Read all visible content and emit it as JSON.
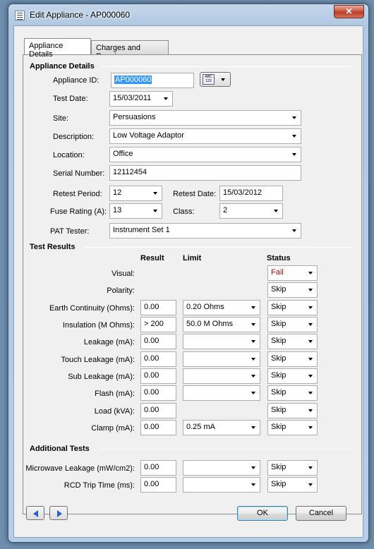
{
  "window": {
    "title": "Edit Appliance - AP000060",
    "close_glyph": "✕"
  },
  "tabs": [
    {
      "label": "Appliance Details"
    },
    {
      "label": "Charges and Repairs"
    }
  ],
  "appliance_details": {
    "section_title": "Appliance Details",
    "appliance_id": {
      "label": "Appliance ID:",
      "value": "AP000060"
    },
    "format_button": {
      "icon": "abc-123-icon",
      "top": "ABC",
      "bottom": "123"
    },
    "test_date": {
      "label": "Test Date:",
      "value": "15/03/2011"
    },
    "site": {
      "label": "Site:",
      "value": "Persuasions"
    },
    "description": {
      "label": "Description:",
      "value": "Low Voltage Adaptor"
    },
    "location": {
      "label": "Location:",
      "value": "Office"
    },
    "serial_number": {
      "label": "Serial Number:",
      "value": "12112454"
    },
    "retest_period": {
      "label": "Retest Period:",
      "value": "12"
    },
    "retest_date": {
      "label": "Retest Date:",
      "value": "15/03/2012"
    },
    "fuse_rating": {
      "label": "Fuse Rating (A):",
      "value": "13"
    },
    "class": {
      "label": "Class:",
      "value": "2"
    },
    "pat_tester": {
      "label": "PAT Tester:",
      "value": "Instrument Set 1"
    }
  },
  "test_results": {
    "section_title": "Test Results",
    "headers": {
      "result": "Result",
      "limit": "Limit",
      "status": "Status"
    },
    "rows": [
      {
        "label": "Visual:",
        "result": null,
        "limit": null,
        "status": "Fail"
      },
      {
        "label": "Polarity:",
        "result": null,
        "limit": null,
        "status": "Skip"
      },
      {
        "label": "Earth Continuity (Ohms):",
        "result": "0.00",
        "limit": "0.20 Ohms",
        "status": "Skip"
      },
      {
        "label": "Insulation (M Ohms):",
        "result": "> 200",
        "limit": "50.0 M Ohms",
        "status": "Skip"
      },
      {
        "label": "Leakage (mA):",
        "result": "0.00",
        "limit": "",
        "status": "Skip"
      },
      {
        "label": "Touch Leakage (mA):",
        "result": "0.00",
        "limit": "",
        "status": "Skip"
      },
      {
        "label": "Sub Leakage (mA):",
        "result": "0.00",
        "limit": "",
        "status": "Skip"
      },
      {
        "label": "Flash (mA):",
        "result": "0.00",
        "limit": "",
        "status": "Skip"
      },
      {
        "label": "Load (kVA):",
        "result": "0.00",
        "limit": null,
        "status": "Skip"
      },
      {
        "label": "Clamp (mA):",
        "result": "0.00",
        "limit": "0.25 mA",
        "status": "Skip"
      }
    ]
  },
  "additional_tests": {
    "section_title": "Additional Tests",
    "rows": [
      {
        "label": "Microwave Leakage (mW/cm2):",
        "result": "0.00",
        "limit": "",
        "status": "Skip"
      },
      {
        "label": "RCD Trip Time (ms):",
        "result": "0.00",
        "limit": "",
        "status": "Skip"
      }
    ]
  },
  "footer": {
    "ok_label": "OK",
    "cancel_label": "Cancel"
  },
  "colors": {
    "fail_text": "#c00000",
    "selection": "#3399ff"
  }
}
